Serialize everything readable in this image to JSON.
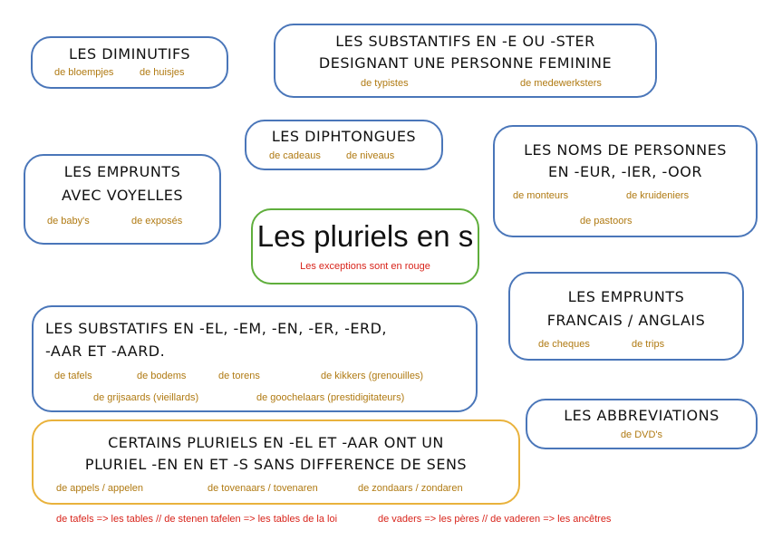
{
  "diminutifs": {
    "title": "LES DIMINUTIFS",
    "ex1": "de bloempjes",
    "ex2": "de huisjes"
  },
  "feminin": {
    "title_line1": "LES SUBSTANTIFS EN -E OU -STER",
    "title_line2": "DESIGNANT UNE PERSONNE FEMININE",
    "ex1": "de typistes",
    "ex2": "de medewerksters"
  },
  "diphtongues": {
    "title": "LES DIPHTONGUES",
    "ex1": "de cadeaus",
    "ex2": "de niveaus"
  },
  "noms_personnes": {
    "title_line1": "LES NOMS DE PERSONNES",
    "title_line2": "EN -EUR, -IER, -OOR",
    "ex1": "de monteurs",
    "ex2": "de kruideniers",
    "ex3": "de pastoors"
  },
  "emprunts_voyelles": {
    "title_line1": "LES EMPRUNTS",
    "title_line2": "AVEC VOYELLES",
    "ex1": "de baby's",
    "ex2": "de exposés"
  },
  "center": {
    "title": "Les pluriels en s",
    "subtitle": "Les exceptions sont en rouge"
  },
  "emprunts_fr_en": {
    "title_line1": "LES EMPRUNTS",
    "title_line2": "FRANCAIS / ANGLAIS",
    "ex1": "de cheques",
    "ex2": "de trips"
  },
  "substatifs": {
    "title_line1": "LES SUBSTATIFS EN -EL, -EM, -EN,  -ER, -ERD,",
    "title_line2": "-AAR ET -AARD.",
    "ex1": "de tafels",
    "ex2": "de bodems",
    "ex3": "de torens",
    "ex4": "de kikkers (grenouilles)",
    "ex5": "de grijsaards (vieillards)",
    "ex6": "de goochelaars (prestidigitateurs)"
  },
  "abbreviations": {
    "title": "LES ABBREVIATIONS",
    "ex1": "de DVD's"
  },
  "certains": {
    "title_line1": "CERTAINS PLURIELS EN -EL ET -AAR ONT UN",
    "title_line2": "PLURIEL -EN EN ET -S SANS DIFFERENCE DE SENS",
    "ex1": "de appels / appelen",
    "ex2": "de tovenaars / tovenaren",
    "ex3": "de zondaars / zondaren"
  },
  "footnotes": {
    "note1": "de tafels => les tables // de stenen tafelen => les tables de la loi",
    "note2": "de vaders => les pères // de vaderen => les ancêtres"
  },
  "colors": {
    "blue_border": "#4a76b9",
    "green_border": "#5fae3c",
    "orange_border": "#e9b23c",
    "example_text": "#b07a12",
    "exception_text": "#d8241b"
  }
}
